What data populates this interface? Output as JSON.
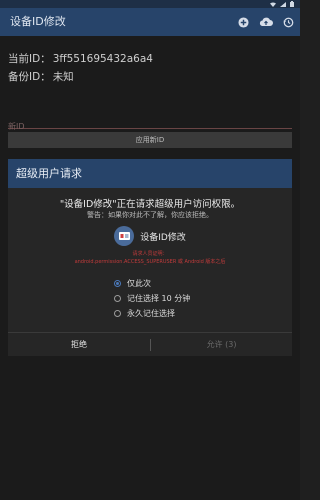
{
  "app": {
    "title": "设备ID修改"
  },
  "info": {
    "current_label": "当前ID：",
    "current_value": "3ff551695432a6a4",
    "backup_label": "备份ID：",
    "backup_value": "未知"
  },
  "form": {
    "id_placeholder": "新ID",
    "apply_button": "应用新ID"
  },
  "dialog": {
    "title": "超级用户请求",
    "message": "\"设备ID修改\"正在请求超级用户访问权限。",
    "warning": "警告：如果你对此不了解，你应该拒绝。",
    "app_name": "设备ID修改",
    "request_line1": "请求人员证明：",
    "request_line2": "android.permission.ACCESS_SUPERUSER 或 Android 版本之后",
    "options": [
      {
        "label": "仅此次",
        "checked": true
      },
      {
        "label": "记住选择 10 分钟",
        "checked": false
      },
      {
        "label": "永久记住选择",
        "checked": false
      }
    ],
    "deny_button": "拒绝",
    "allow_button": "允许 (3)"
  },
  "colors": {
    "app_bar": "#27446a",
    "status_bar": "#1e2f46",
    "background": "#1b1b1b",
    "dialog_bg": "#262626",
    "accent": "#4a78b8",
    "warning_red": "#c23b3b"
  },
  "icons": {
    "app_bar": [
      "add-circle-icon",
      "cloud-upload-icon",
      "history-icon"
    ],
    "status": [
      "wifi-icon",
      "signal-icon",
      "battery-icon"
    ],
    "app": "device-id-icon"
  }
}
